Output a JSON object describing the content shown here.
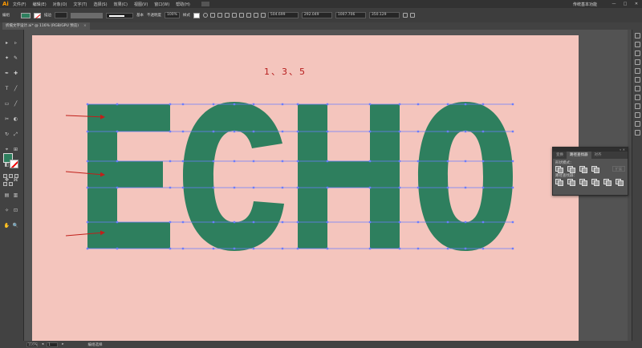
{
  "app": {
    "logo": "Ai",
    "menu": [
      "文件(F)",
      "编辑(E)",
      "对象(O)",
      "文字(T)",
      "选择(S)",
      "效果(C)",
      "视图(V)",
      "窗口(W)",
      "帮助(H)"
    ],
    "workspace": "传统基本功能",
    "window_controls": [
      "—",
      "□",
      "✕"
    ]
  },
  "options_bar": {
    "object_label": "编组",
    "stroke_label": "描边",
    "profile_label": "等比",
    "brush_label": "基本",
    "opacity_label": "不透明度",
    "opacity_value": "100%",
    "style_label": "样式",
    "x_value": "504.699",
    "y_value": "292.049",
    "w_value": "1007.706",
    "h_value": "350.129"
  },
  "document": {
    "tab_title": "折痕文字设计.ai* @ 116% (RGB/GPU 预览)",
    "close": "×"
  },
  "canvas": {
    "annotation": "1、3、5",
    "word": [
      "E",
      "C",
      "H",
      "O"
    ],
    "text_color": "#2e7f5e",
    "background": "#f4c5bd",
    "guide_color": "#6b7dff",
    "arrow_color": "#c0201a"
  },
  "panel": {
    "tabs": [
      "变换",
      "路径查找器",
      "对齐"
    ],
    "active_tab": "路径查找器",
    "section1": "形状模式：",
    "expand_button": "扩展",
    "section2": "路径查找器："
  },
  "status": {
    "zoom": "116%",
    "page": "1",
    "tool_label": "编组选择"
  },
  "tools": [
    "▸",
    "▹",
    "✦",
    "✎",
    "✒",
    "✚",
    "T",
    "╱",
    "▭",
    "╱",
    "✂",
    "◐",
    "↻",
    "⤢",
    "⌖",
    "⊞",
    "◧",
    "▦",
    "✥",
    "⌘",
    "▤",
    "▥",
    "✧",
    "⊡",
    "✋",
    "🔍"
  ]
}
